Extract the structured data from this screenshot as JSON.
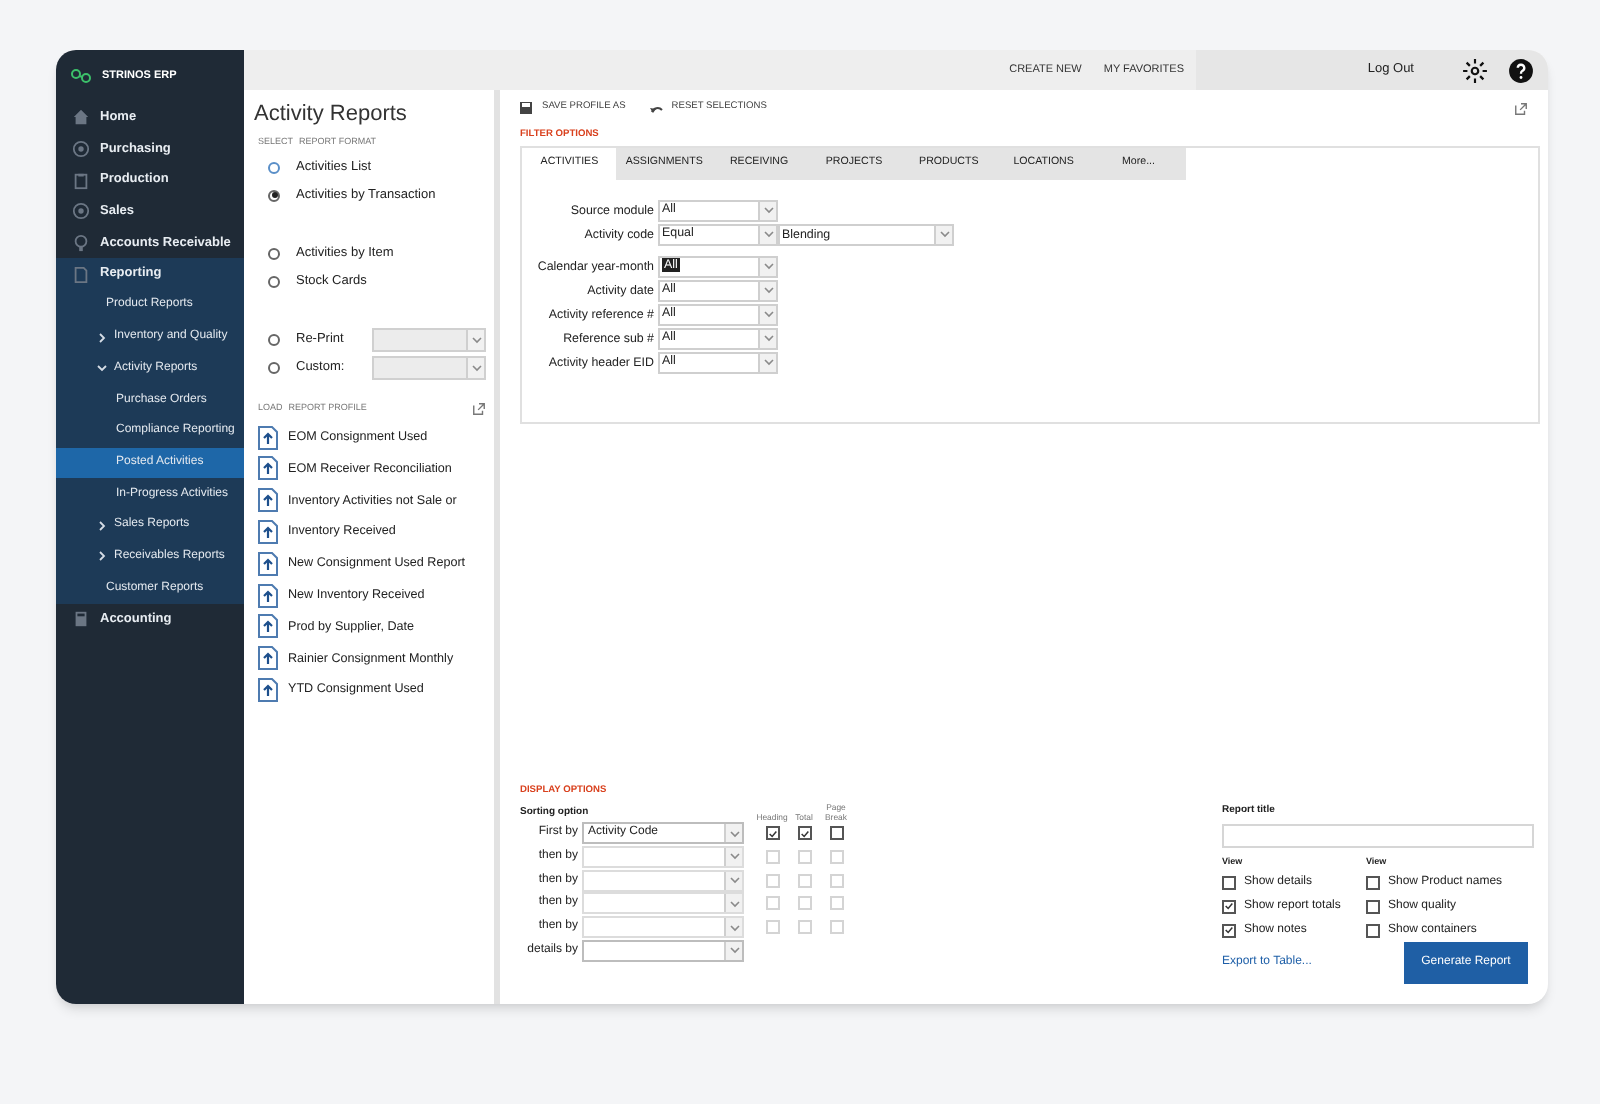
{
  "brand": "STRINOS ERP",
  "sidebar": {
    "items": [
      {
        "label": "Home",
        "selected": false
      },
      {
        "label": "Purchasing",
        "selected": false
      },
      {
        "label": "Production",
        "selected": false
      },
      {
        "label": "Sales",
        "selected": false
      },
      {
        "label": "Accounts Receivable",
        "selected": false
      },
      {
        "label": "Reporting",
        "selected": true,
        "children": [
          {
            "label": "Product Reports",
            "selected": false
          },
          {
            "label": "Inventory and Quality",
            "expanded": false,
            "selected": false
          },
          {
            "label": "Activity Reports",
            "expanded": true,
            "selected": false,
            "children": [
              {
                "label": "Purchase Orders",
                "selected": false
              },
              {
                "label": "Compliance Reporting",
                "selected": false
              },
              {
                "label": "Posted Activities",
                "selected": true
              },
              {
                "label": "In-Progress Activities",
                "selected": false
              }
            ]
          },
          {
            "label": "Sales Reports",
            "expanded": false,
            "selected": false
          },
          {
            "label": "Receivables Reports",
            "expanded": false,
            "selected": false
          },
          {
            "label": "Customer Reports",
            "selected": false
          }
        ]
      },
      {
        "label": "Accounting",
        "selected": false
      }
    ]
  },
  "topbar": {
    "links": [
      "CREATE NEW",
      "MY FAVORITES"
    ],
    "logout": "Log Out"
  },
  "left_panel": {
    "title": "Activity Reports",
    "format_header": [
      "SELECT",
      "REPORT FORMAT"
    ],
    "format_groups": [
      [
        {
          "label": "Activities List",
          "selected": false,
          "kind": "plain"
        },
        {
          "label": "Activities by Transaction",
          "selected": true,
          "kind": "plain"
        }
      ],
      [
        {
          "label": "Activities by Item",
          "selected": false,
          "kind": "plain"
        },
        {
          "label": "Stock Cards",
          "selected": false,
          "kind": "plain"
        }
      ],
      [
        {
          "label": "Re-Print",
          "selected": false,
          "kind": "select"
        },
        {
          "label": "Custom:",
          "selected": false,
          "kind": "select"
        }
      ]
    ],
    "profile_header": [
      "LOAD",
      "REPORT PROFILE"
    ],
    "profiles": [
      "EOM Consignment Used",
      "EOM Receiver Reconciliation",
      "Inventory Activities not Sale or",
      "Inventory Received",
      "New Consignment Used Report",
      "New Inventory Received",
      "Prod by Supplier, Date",
      "Rainier Consignment Monthly",
      "YTD Consignment Used"
    ]
  },
  "toolbar": [
    "SAVE PROFILE AS",
    "RESET SELECTIONS"
  ],
  "filter_options": {
    "title": "FILTER OPTIONS",
    "tabs": [
      {
        "label": "ACTIVITIES",
        "selected": true
      },
      {
        "label": "ASSIGNMENTS",
        "selected": false
      },
      {
        "label": "RECEIVING",
        "selected": false
      },
      {
        "label": "PROJECTS",
        "selected": false
      },
      {
        "label": "PRODUCTS",
        "selected": false
      },
      {
        "label": "LOCATIONS",
        "selected": false
      },
      {
        "label": "More...",
        "selected": false
      }
    ],
    "field_groups": [
      [
        {
          "label": "Source module",
          "value": "All",
          "highlighted": false
        },
        {
          "label": "Activity code",
          "value": "Equal",
          "extra": "Blending",
          "highlighted": false
        }
      ],
      [
        {
          "label": "Calendar year-month",
          "value": "All",
          "highlighted": true
        },
        {
          "label": "Activity date",
          "value": "All",
          "highlighted": false
        },
        {
          "label": "Activity reference #",
          "value": "All",
          "highlighted": false
        },
        {
          "label": "Reference sub #",
          "value": "All",
          "highlighted": false
        },
        {
          "label": "Activity header EID",
          "value": "All",
          "highlighted": false
        }
      ]
    ]
  },
  "display_options": {
    "title": "DISPLAY OPTIONS",
    "sorting_label": "Sorting option",
    "columns": [
      "Heading",
      "Total",
      "Page Break"
    ],
    "rows": [
      {
        "label": "First by",
        "value": "Activity Code",
        "heading": true,
        "total": true,
        "page_break": false,
        "enabled": true,
        "checks": true
      },
      {
        "label": "then by",
        "heading": false,
        "total": false,
        "page_break": false,
        "enabled": false,
        "checks": true
      },
      {
        "label": "then by",
        "heading": false,
        "total": false,
        "page_break": false,
        "enabled": false,
        "checks": true
      },
      {
        "label": "then by",
        "heading": false,
        "total": false,
        "page_break": false,
        "enabled": false,
        "checks": true
      },
      {
        "label": "then by",
        "heading": false,
        "total": false,
        "page_break": false,
        "enabled": false,
        "checks": true
      },
      {
        "label": "details by",
        "enabled": true,
        "checks": false
      }
    ],
    "report_title_label": "Report title",
    "views": [
      {
        "header": "View",
        "items": [
          {
            "label": "Show details",
            "checked": false
          },
          {
            "label": "Show report totals",
            "checked": true
          },
          {
            "label": "Show notes",
            "checked": true
          }
        ]
      },
      {
        "header": "View",
        "items": [
          {
            "label": "Show Product names",
            "checked": false
          },
          {
            "label": "Show quality",
            "checked": false
          },
          {
            "label": "Show containers",
            "checked": false
          }
        ]
      }
    ],
    "export_link": "Export to Table...",
    "generate_button": "Generate Report"
  }
}
